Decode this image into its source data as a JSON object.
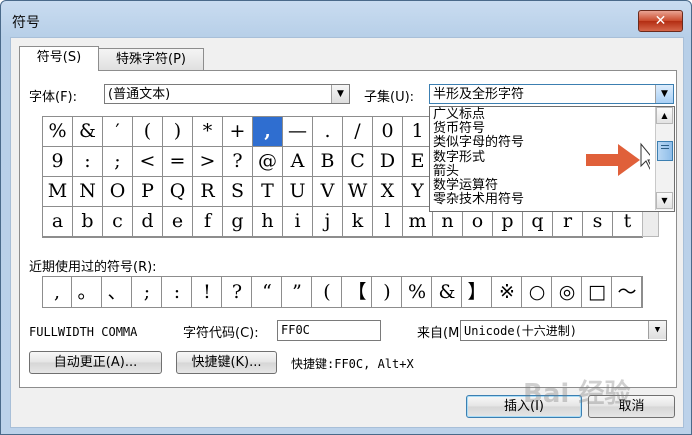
{
  "window": {
    "title": "符号",
    "close": "✕"
  },
  "tabs": [
    {
      "label": "符号(S)",
      "active": true
    },
    {
      "label": "特殊字符(P)",
      "active": false
    }
  ],
  "font": {
    "label": "字体(F):",
    "value": "(普通文本)"
  },
  "subset": {
    "label": "子集(U):",
    "value": "半形及全形字符",
    "options": [
      "广义标点",
      "货币符号",
      "类似字母的符号",
      "数字形式",
      "箭头",
      "数学运算符",
      "零杂技术用符号"
    ]
  },
  "symbols": {
    "rows": [
      [
        "%",
        "&",
        "′",
        "(",
        ")",
        "*",
        "+",
        ",",
        "—",
        ".",
        "/",
        "0",
        "1",
        "",
        "",
        "",
        "",
        "",
        "",
        ""
      ],
      [
        "9",
        ":",
        ";",
        "<",
        "=",
        ">",
        "?",
        "@",
        "A",
        "B",
        "C",
        "D",
        "E",
        "",
        "",
        "",
        "",
        "",
        "",
        ""
      ],
      [
        "M",
        "N",
        "O",
        "P",
        "Q",
        "R",
        "S",
        "T",
        "U",
        "V",
        "W",
        "X",
        "Y",
        "",
        "",
        "",
        "",
        "",
        "",
        ""
      ],
      [
        "a",
        "b",
        "c",
        "d",
        "e",
        "f",
        "g",
        "h",
        "i",
        "j",
        "k",
        "l",
        "m",
        "n",
        "o",
        "p",
        "q",
        "r",
        "s",
        "t"
      ]
    ],
    "selected": ","
  },
  "recent": {
    "label": "近期使用过的符号(R):",
    "items": [
      ",",
      "。",
      "、",
      ";",
      ":",
      "!",
      "?",
      "“",
      "”",
      "(",
      "【",
      ")",
      "%",
      "&",
      "】",
      "※",
      "○",
      "◎",
      "□",
      "～"
    ]
  },
  "char_name": "FULLWIDTH COMMA",
  "char_code": {
    "label": "字符代码(C):",
    "value": "FF0C"
  },
  "from": {
    "label": "来自(M):",
    "value": "Unicode(十六进制)"
  },
  "buttons": {
    "autocorrect": "自动更正(A)...",
    "shortcut_key": "快捷键(K)...",
    "shortcut_text": "快捷键:FF0C, Alt+X",
    "insert": "插入(I)",
    "cancel": "取消"
  },
  "watermark": "Bai 经验",
  "colors": {
    "selected_cell": "#2f6ed0",
    "close_button": "#c9492b",
    "annotation_arrow": "#e0603a"
  }
}
